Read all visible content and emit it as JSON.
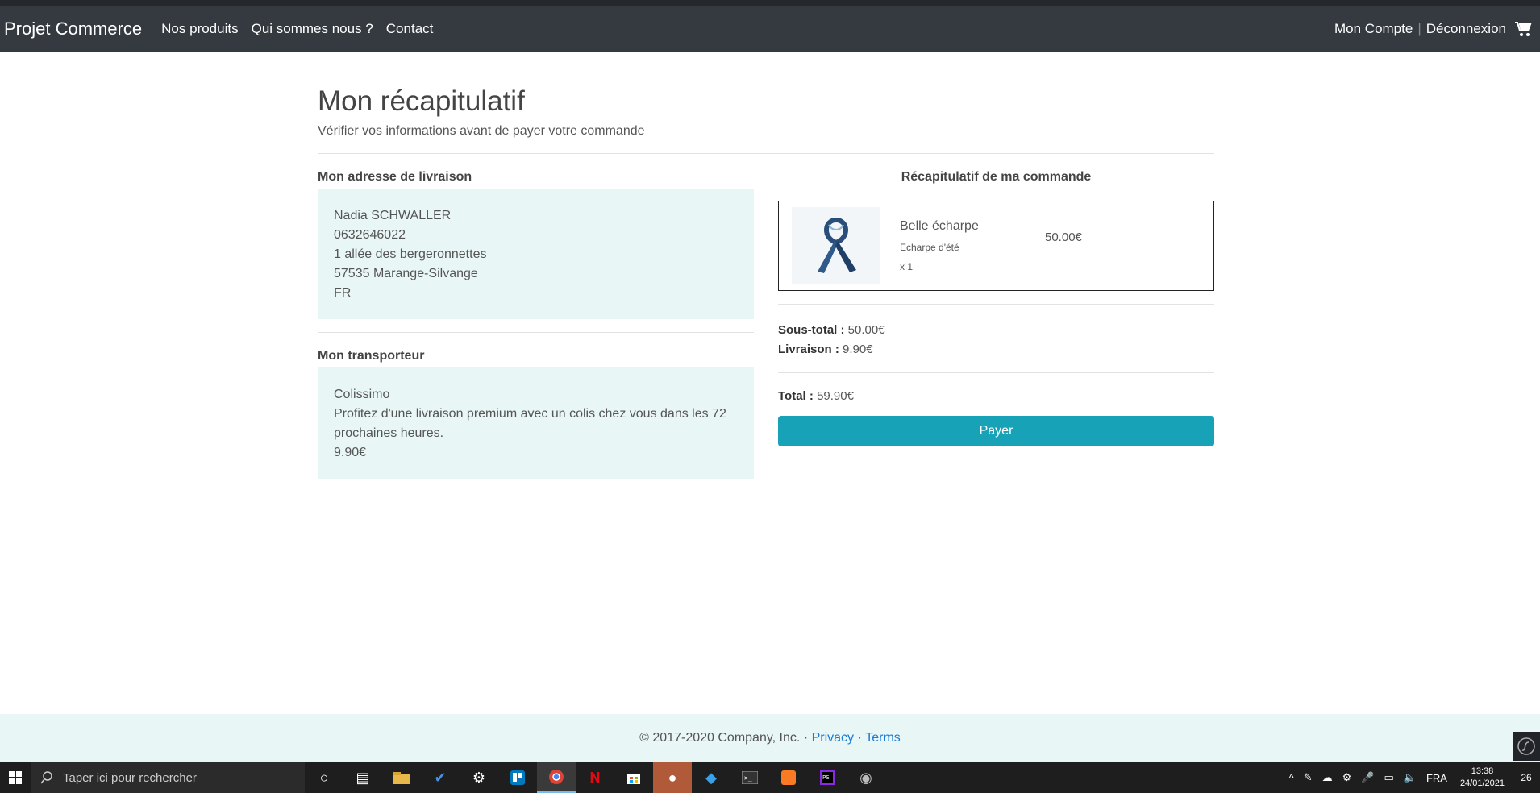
{
  "nav": {
    "brand": "Projet Commerce",
    "links": [
      "Nos produits",
      "Qui sommes nous ?",
      "Contact"
    ],
    "account": "Mon Compte",
    "separator": "|",
    "logout": "Déconnexion"
  },
  "page": {
    "title": "Mon récapitulatif",
    "subtitle": "Vérifier vos informations avant de payer votre commande"
  },
  "address": {
    "heading": "Mon adresse de livraison",
    "lines": [
      "Nadia SCHWALLER",
      "0632646022",
      "1 allée des bergeronnettes",
      "57535 Marange-Silvange",
      "FR"
    ]
  },
  "carrier": {
    "heading": "Mon transporteur",
    "name": "Colissimo",
    "description": "Profitez d'une livraison premium avec un colis chez vous dans les 72 prochaines heures.",
    "price": "9.90€"
  },
  "order": {
    "heading": "Récapitulatif de ma commande",
    "product": {
      "name": "Belle écharpe",
      "description": "Echarpe d'été",
      "quantity": "x 1",
      "price": "50.00€"
    },
    "subtotal_label": "Sous-total :",
    "subtotal": "50.00€",
    "shipping_label": "Livraison :",
    "shipping": "9.90€",
    "total_label": "Total :",
    "total": "59.90€",
    "pay_label": "Payer"
  },
  "footer": {
    "copyright": "© 2017-2020 Company, Inc. ·",
    "privacy": "Privacy",
    "dot": "·",
    "terms": "Terms"
  },
  "taskbar": {
    "search_placeholder": "Taper ici pour rechercher",
    "language": "FRA",
    "time": "13:38",
    "date": "24/01/2021",
    "notifications": "26"
  },
  "colors": {
    "navbar": "#343a40",
    "accent": "#17a2b8",
    "box_bg": "#e9f6f6",
    "link": "#1a7ad4"
  }
}
